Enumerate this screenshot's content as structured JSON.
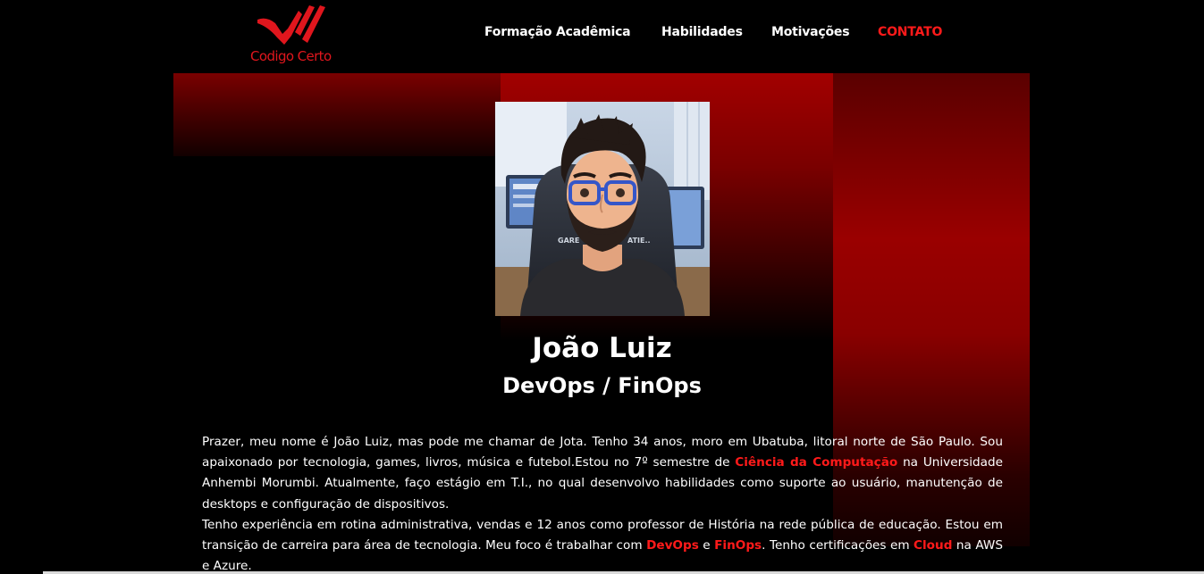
{
  "colors": {
    "accent": "#ff1a1a",
    "background": "#000000",
    "text": "#ffffff"
  },
  "logo": {
    "text": "Codigo Certo",
    "icon": "red-stripes-logo-icon"
  },
  "nav": {
    "items": [
      {
        "label": "Formação Acadêmica",
        "active": false
      },
      {
        "label": "Habilidades",
        "active": false
      },
      {
        "label": "Motivações",
        "active": false
      },
      {
        "label": "CONTATO",
        "active": true
      }
    ]
  },
  "profile": {
    "avatar_icon": "avatar-illustration",
    "name": "João Luiz",
    "role": "DevOps / FinOps"
  },
  "bio": {
    "p1": {
      "s1": "Prazer, meu nome é João Luiz, mas pode me chamar de Jota. Tenho 34 anos, moro em Ubatuba, litoral norte de São Paulo. Sou apaixonado por tecnologia, games, livros, música e futebol.Estou no 7º semestre de ",
      "h1": "Ciência da Computação",
      "s2": " na Universidade Anhembi Morumbi. Atualmente, faço estágio em T.I., no qual desenvolvo habilidades como suporte ao usuário, manutenção de desktops e configuração de dispositivos."
    },
    "p2": {
      "s1": "Tenho experiência em rotina administrativa, vendas e 12 anos como professor de História na rede pública de educação. Estou em transição de carreira para área de tecnologia. Meu foco é trabalhar com ",
      "h1": "DevOps",
      "s2": " e ",
      "h2": "FinOps",
      "s3": ". Tenho certificações em ",
      "h3": "Cloud",
      "s4": " na AWS e Azure."
    }
  }
}
